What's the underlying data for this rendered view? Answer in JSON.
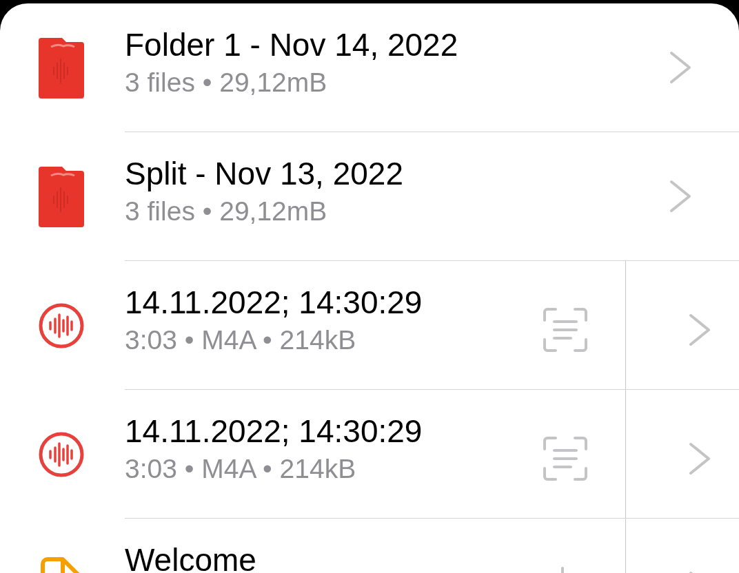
{
  "items": [
    {
      "kind": "folder",
      "title": "Folder 1 - Nov 14, 2022",
      "subtitle": "3 files • 29,12mB"
    },
    {
      "kind": "folder",
      "title": "Split - Nov 13, 2022",
      "subtitle": "3 files • 29,12mB"
    },
    {
      "kind": "recording",
      "title": "14.11.2022; 14:30:29",
      "subtitle": "3:03 • M4A • 214kB"
    },
    {
      "kind": "recording",
      "title": "14.11.2022; 14:30:29",
      "subtitle": "3:03 • M4A • 214kB"
    },
    {
      "kind": "document",
      "title": "Welcome"
    }
  ]
}
